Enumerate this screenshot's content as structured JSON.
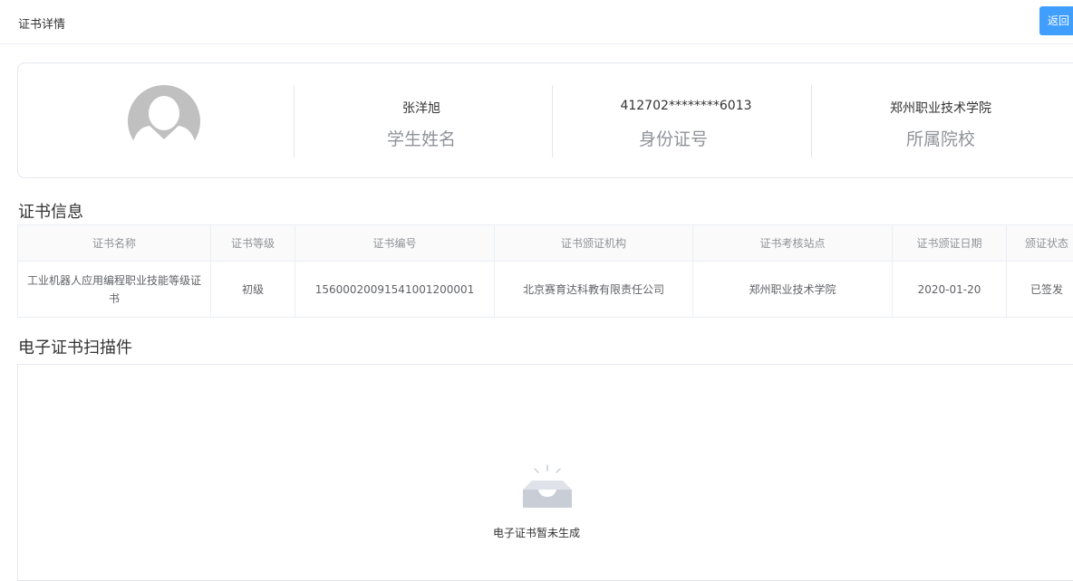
{
  "header": {
    "title": "证书详情",
    "back_label": "返回"
  },
  "profile": {
    "name": "张洋旭",
    "name_label": "学生姓名",
    "id_number": "412702********6013",
    "id_label": "身份证号",
    "school": "郑州职业技术学院",
    "school_label": "所属院校"
  },
  "sections": {
    "cert_info": "证书信息",
    "scan": "电子证书扫描件"
  },
  "table": {
    "headers": [
      "证书名称",
      "证书等级",
      "证书编号",
      "证书颁证机构",
      "证书考核站点",
      "证书颁证日期",
      "颁证状态"
    ],
    "rows": [
      [
        "工业机器人应用编程职业技能等级证书",
        "初级",
        "15600020091541001200001",
        "北京赛育达科教有限责任公司",
        "郑州职业技术学院",
        "2020-01-20",
        "已签发"
      ]
    ]
  },
  "empty": {
    "text": "电子证书暂未生成"
  },
  "colors": {
    "accent": "#409eff",
    "status_green": "#3eaf2c"
  }
}
